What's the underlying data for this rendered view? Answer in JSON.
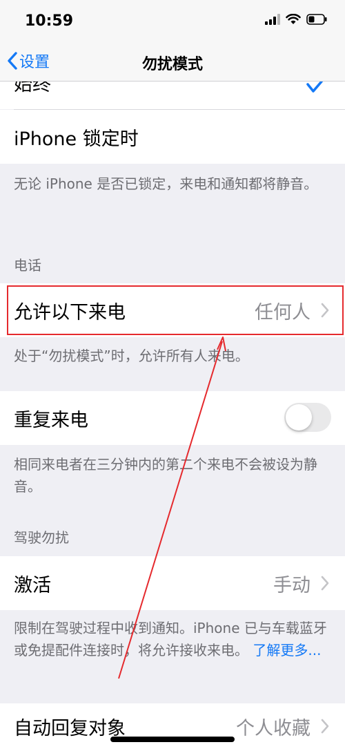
{
  "status_bar": {
    "time": "10:59"
  },
  "nav": {
    "back_label": "设置",
    "title": "勿扰模式"
  },
  "rows": {
    "always": {
      "label": "始终"
    },
    "iphone_locked": {
      "label": "iPhone 锁定时"
    },
    "allow_calls": {
      "label": "允许以下来电",
      "value": "任何人"
    },
    "repeated_calls": {
      "label": "重复来电",
      "toggle_on": false
    },
    "activate": {
      "label": "激活",
      "value": "手动"
    },
    "auto_reply_to": {
      "label": "自动回复对象",
      "value": "个人收藏"
    }
  },
  "footers": {
    "locked_note": "无论 iPhone 是否已锁定，来电和通知都将静音。",
    "allow_note": "处于“勿扰模式”时，允许所有人来电。",
    "repeat_note": "相同来电者在三分钟内的第二个来电不会被设为静音。",
    "driving_note": "限制在驾驶过程中收到通知。iPhone 已与车载蓝牙或免提配件连接时，将允许接收来电。",
    "learn_more": "了解更多..."
  },
  "sections": {
    "phone": "电话",
    "driving": "驾驶勿扰"
  },
  "colors": {
    "accent": "#1479f6",
    "highlight": "#e5292d"
  }
}
